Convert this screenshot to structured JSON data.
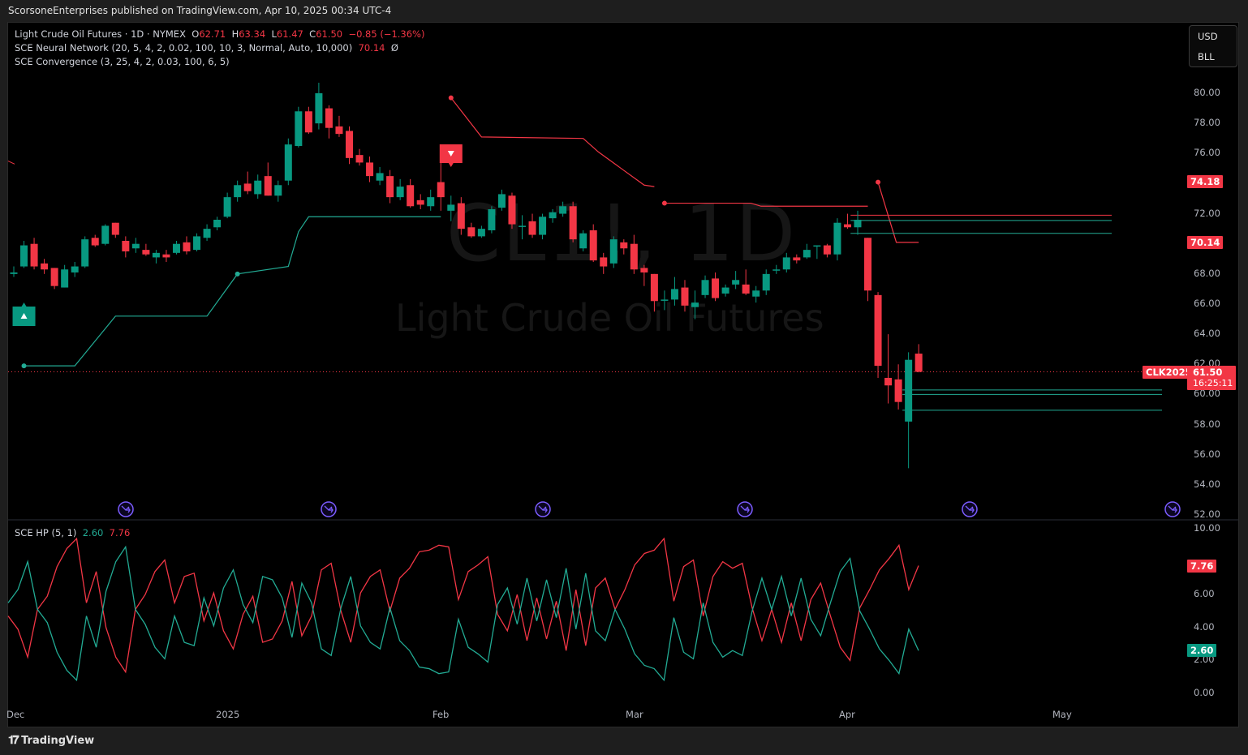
{
  "header": {
    "published": "ScorsoneEnterprises published on TradingView.com, Apr 10, 2025 00:34 UTC-4"
  },
  "legend": {
    "symbol": "Light Crude Oil Futures · 1D · NYMEX",
    "o_label": "O",
    "o": "62.71",
    "h_label": "H",
    "h": "63.34",
    "l_label": "L",
    "l": "61.47",
    "c_label": "C",
    "c": "61.50",
    "change": "−0.85 (−1.36%)",
    "nn_name": "SCE Neural Network (20, 5, 4, 2, 0.02, 100, 10, 3, Normal, Auto, 10,000)",
    "nn_value": "70.14",
    "nn_extra": "Ø",
    "conv_name": "SCE Convergence (3, 25, 4, 2, 0.03, 100, 6, 5)",
    "hp_name": "SCE HP (5, 1)",
    "hp_teal": "2.60",
    "hp_red": "7.76"
  },
  "unit_box": {
    "currency": "USD",
    "unit": "BLL"
  },
  "watermark": {
    "symbol": "CL1!, 1D",
    "name": "Light Crude Oil Futures"
  },
  "tags": {
    "upper_line": "74.18",
    "nn_line": "70.14",
    "contract": "CLK2025",
    "last_price": "61.50",
    "countdown": "16:25:11",
    "hp_red": "7.76",
    "hp_teal": "2.60"
  },
  "footer": {
    "brand": "TradingView"
  },
  "colors": {
    "up": "#089981",
    "down": "#f23645",
    "teal_line": "#22ab94",
    "red_line": "#f23645",
    "event": "#7b5cff"
  },
  "chart_data": [
    {
      "type": "candlestick",
      "title": "Light Crude Oil Futures · 1D · NYMEX",
      "y_ticks": [
        80,
        78,
        76,
        72,
        68,
        66,
        64,
        62,
        60,
        58,
        56,
        54,
        52
      ],
      "ylim": [
        52,
        80
      ],
      "x_ticks": [
        "Dec",
        "2025",
        "Feb",
        "Mar",
        "Apr",
        "May"
      ],
      "ohlc": [
        [
          68.0,
          68.5,
          67.8,
          68.1
        ],
        [
          68.5,
          70.2,
          68.4,
          69.9
        ],
        [
          70.0,
          70.4,
          68.3,
          68.5
        ],
        [
          68.7,
          69.0,
          68.0,
          68.3
        ],
        [
          68.4,
          68.4,
          67.0,
          67.2
        ],
        [
          67.1,
          68.6,
          67.1,
          68.3
        ],
        [
          68.1,
          68.8,
          67.8,
          68.5
        ],
        [
          68.5,
          70.5,
          68.4,
          70.3
        ],
        [
          70.4,
          70.6,
          69.8,
          69.9
        ],
        [
          70.0,
          71.3,
          69.9,
          71.2
        ],
        [
          71.4,
          71.4,
          70.4,
          70.6
        ],
        [
          70.2,
          70.5,
          69.1,
          69.5
        ],
        [
          69.7,
          70.4,
          69.4,
          70.0
        ],
        [
          69.6,
          70.0,
          69.2,
          69.3
        ],
        [
          69.1,
          69.6,
          68.7,
          69.4
        ],
        [
          69.3,
          69.6,
          68.8,
          69.1
        ],
        [
          69.4,
          70.2,
          69.3,
          70.0
        ],
        [
          70.1,
          70.5,
          69.3,
          69.5
        ],
        [
          69.6,
          70.7,
          69.5,
          70.5
        ],
        [
          70.4,
          71.3,
          70.2,
          71.0
        ],
        [
          71.1,
          71.8,
          70.9,
          71.6
        ],
        [
          71.8,
          73.4,
          71.7,
          73.1
        ],
        [
          73.1,
          74.2,
          72.8,
          73.9
        ],
        [
          74.0,
          74.8,
          73.3,
          73.5
        ],
        [
          73.3,
          74.6,
          73.0,
          74.2
        ],
        [
          74.5,
          75.4,
          73.2,
          73.2
        ],
        [
          73.2,
          74.2,
          72.8,
          73.9
        ],
        [
          74.2,
          77.0,
          73.9,
          76.6
        ],
        [
          76.5,
          79.1,
          76.4,
          78.8
        ],
        [
          78.8,
          79.1,
          77.3,
          77.4
        ],
        [
          78.0,
          80.7,
          77.6,
          80.0
        ],
        [
          79.0,
          79.2,
          77.0,
          77.7
        ],
        [
          77.8,
          78.5,
          77.1,
          77.3
        ],
        [
          77.5,
          77.8,
          75.3,
          75.7
        ],
        [
          75.9,
          76.3,
          75.2,
          75.4
        ],
        [
          75.4,
          75.8,
          74.1,
          74.5
        ],
        [
          74.2,
          75.1,
          73.9,
          74.7
        ],
        [
          74.5,
          74.9,
          72.7,
          73.1
        ],
        [
          73.1,
          74.3,
          72.9,
          73.8
        ],
        [
          73.9,
          74.3,
          72.4,
          72.5
        ],
        [
          72.9,
          73.3,
          72.3,
          72.6
        ],
        [
          72.5,
          73.6,
          72.2,
          73.1
        ],
        [
          74.1,
          75.6,
          72.2,
          73.1
        ],
        [
          72.2,
          73.2,
          71.5,
          72.6
        ],
        [
          72.7,
          73.1,
          70.6,
          71.0
        ],
        [
          71.1,
          71.4,
          70.4,
          70.5
        ],
        [
          70.5,
          71.2,
          70.4,
          71.0
        ],
        [
          70.9,
          72.5,
          70.7,
          72.3
        ],
        [
          72.4,
          73.6,
          72.2,
          73.3
        ],
        [
          73.2,
          73.4,
          71.0,
          71.3
        ],
        [
          71.2,
          71.9,
          70.3,
          71.2
        ],
        [
          71.5,
          72.0,
          70.4,
          70.6
        ],
        [
          70.6,
          72.0,
          70.3,
          71.8
        ],
        [
          71.7,
          72.3,
          71.4,
          72.1
        ],
        [
          72.0,
          72.8,
          71.8,
          72.5
        ],
        [
          72.5,
          72.8,
          70.1,
          70.3
        ],
        [
          69.7,
          70.9,
          69.5,
          70.7
        ],
        [
          70.9,
          71.3,
          68.8,
          68.9
        ],
        [
          69.1,
          69.4,
          68.0,
          68.5
        ],
        [
          68.7,
          70.5,
          68.4,
          70.3
        ],
        [
          70.1,
          70.3,
          69.3,
          69.7
        ],
        [
          70.0,
          70.6,
          68.0,
          68.3
        ],
        [
          68.4,
          68.6,
          67.2,
          68.1
        ],
        [
          68.0,
          68.0,
          65.5,
          66.2
        ],
        [
          66.3,
          66.9,
          65.6,
          66.3
        ],
        [
          66.3,
          67.8,
          65.9,
          67.0
        ],
        [
          67.1,
          67.6,
          65.5,
          65.9
        ],
        [
          65.8,
          66.9,
          65.0,
          66.1
        ],
        [
          66.6,
          67.9,
          66.4,
          67.6
        ],
        [
          67.7,
          68.1,
          66.2,
          66.4
        ],
        [
          66.7,
          67.3,
          66.5,
          67.1
        ],
        [
          67.3,
          68.2,
          67.0,
          67.6
        ],
        [
          67.3,
          68.3,
          66.6,
          66.7
        ],
        [
          66.5,
          67.2,
          66.1,
          66.9
        ],
        [
          66.9,
          68.3,
          66.6,
          68.0
        ],
        [
          68.3,
          68.6,
          68.0,
          68.3
        ],
        [
          68.3,
          69.4,
          68.1,
          69.1
        ],
        [
          69.1,
          69.3,
          68.7,
          68.9
        ],
        [
          69.1,
          70.0,
          69.0,
          69.6
        ],
        [
          69.9,
          69.9,
          69.0,
          69.9
        ],
        [
          69.9,
          70.0,
          69.1,
          69.3
        ],
        [
          69.3,
          71.7,
          68.9,
          71.4
        ],
        [
          71.3,
          72.0,
          71.0,
          71.1
        ],
        [
          71.1,
          72.2,
          70.6,
          71.6
        ],
        [
          70.4,
          70.4,
          66.2,
          66.9
        ],
        [
          66.6,
          66.8,
          61.1,
          61.9
        ],
        [
          61.1,
          64.0,
          59.4,
          60.6
        ],
        [
          61.0,
          62.0,
          59.0,
          59.5
        ],
        [
          58.2,
          62.8,
          55.1,
          62.3
        ],
        [
          62.71,
          63.34,
          61.47,
          61.5
        ]
      ],
      "last_price": 61.5,
      "nn_support_line": [
        [
          1,
          61.9
        ],
        [
          6,
          61.9
        ],
        [
          10,
          65.2
        ],
        [
          19,
          65.2
        ],
        [
          22,
          68.0
        ],
        [
          27,
          68.5
        ],
        [
          28,
          70.8
        ],
        [
          29,
          71.8
        ],
        [
          42,
          71.8
        ]
      ],
      "nn_resistance_line": [
        [
          43,
          79.7
        ],
        [
          46,
          77.1
        ],
        [
          56,
          77.0
        ],
        [
          57.5,
          76.1
        ],
        [
          62,
          73.9
        ],
        [
          63,
          73.8
        ]
      ],
      "nn_resistance_line_2": [
        [
          64,
          72.7
        ],
        [
          72.5,
          72.7
        ],
        [
          73.5,
          72.5
        ],
        [
          84,
          72.5
        ]
      ],
      "nn_resistance_line_3": [
        [
          85,
          74.1
        ],
        [
          86.8,
          70.1
        ],
        [
          89,
          70.1
        ]
      ],
      "resistance_levels": [
        71.9
      ],
      "support_levels_upper": [
        71.55,
        70.7
      ],
      "support_levels_lower": [
        60.3,
        60.0,
        58.95
      ],
      "signals": [
        {
          "type": "buy",
          "bar": 1
        },
        {
          "type": "sell",
          "bar": 43
        }
      ]
    },
    {
      "type": "line",
      "title": "SCE HP (5, 1)",
      "ylim": [
        -0.5,
        10
      ],
      "y_ticks": [
        10,
        6,
        4,
        2,
        0
      ],
      "series": [
        {
          "name": "HP red",
          "color": "#f23645",
          "values": [
            4.7,
            3.9,
            2.2,
            5.1,
            5.9,
            7.7,
            8.8,
            9.4,
            5.5,
            7.4,
            4.0,
            2.2,
            1.3,
            5.1,
            6.0,
            7.4,
            8.1,
            5.5,
            7.1,
            7.3,
            4.4,
            6.1,
            3.8,
            2.7,
            4.8,
            5.9,
            3.1,
            3.3,
            4.4,
            6.8,
            3.5,
            4.7,
            7.5,
            7.9,
            5.0,
            3.1,
            6.1,
            7.1,
            7.5,
            5.0,
            7.0,
            7.6,
            8.6,
            8.7,
            9.0,
            8.9,
            5.7,
            7.4,
            7.8,
            8.3,
            4.8,
            3.8,
            6.0,
            3.2,
            5.8,
            3.3,
            5.6,
            2.6,
            6.3,
            2.9,
            6.4,
            7.0,
            5.1,
            6.3,
            7.8,
            8.5,
            8.7,
            9.4,
            5.6,
            7.7,
            8.1,
            4.7,
            7.1,
            8.0,
            7.6,
            7.9,
            5.2,
            3.2,
            5.1,
            3.1,
            5.5,
            3.2,
            5.7,
            6.7,
            4.7,
            2.8,
            2.0,
            5.2,
            6.3,
            7.5,
            8.2,
            9.0,
            6.3,
            7.76
          ]
        },
        {
          "name": "HP teal",
          "color": "#22ab94",
          "values": [
            5.5,
            6.3,
            8.0,
            5.1,
            4.3,
            2.5,
            1.4,
            0.8,
            4.7,
            2.8,
            6.2,
            8.0,
            8.9,
            5.1,
            4.2,
            2.8,
            2.1,
            4.7,
            3.1,
            2.9,
            5.8,
            4.1,
            6.4,
            7.5,
            5.4,
            4.3,
            7.1,
            6.9,
            5.8,
            3.4,
            6.7,
            5.5,
            2.7,
            2.3,
            5.2,
            7.1,
            4.1,
            3.1,
            2.7,
            5.2,
            3.2,
            2.6,
            1.6,
            1.5,
            1.2,
            1.3,
            4.5,
            2.8,
            2.4,
            1.9,
            5.4,
            6.4,
            4.2,
            7.0,
            4.4,
            6.9,
            4.6,
            7.6,
            3.9,
            7.3,
            3.8,
            3.2,
            5.1,
            3.9,
            2.4,
            1.7,
            1.5,
            0.8,
            4.6,
            2.5,
            2.1,
            5.5,
            3.1,
            2.2,
            2.6,
            2.3,
            5.0,
            7.0,
            5.1,
            7.1,
            4.7,
            7.0,
            4.5,
            3.5,
            5.5,
            7.4,
            8.2,
            5.0,
            3.9,
            2.7,
            2.0,
            1.2,
            3.9,
            2.6
          ]
        }
      ]
    }
  ]
}
